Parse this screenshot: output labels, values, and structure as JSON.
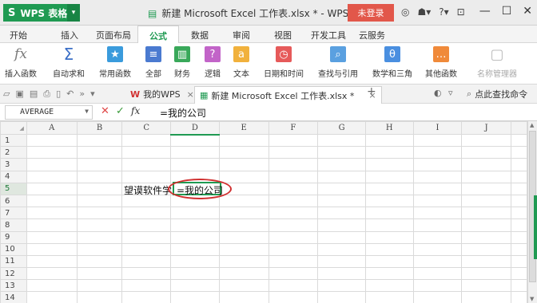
{
  "titlebar": {
    "app_name": "WPS 表格",
    "document_title": "新建 Microsoft Excel 工作表.xlsx * - WPS 表格",
    "login_label": "未登录",
    "min_icon": "minimize-icon",
    "max_icon": "maximize-icon",
    "close_icon": "close-icon"
  },
  "menu": {
    "tabs": [
      "开始",
      "插入",
      "页面布局",
      "公式",
      "数据",
      "审阅",
      "视图",
      "开发工具",
      "云服务"
    ],
    "active": "公式"
  },
  "ribbon": {
    "buttons": [
      {
        "label": "插入函数",
        "icon": "fx-icon",
        "color": "#7a7a7a"
      },
      {
        "label": "自动求和",
        "icon": "sigma-icon",
        "color": "#3b6fc7"
      },
      {
        "label": "常用函数",
        "icon": "star-box-icon",
        "color": "#3a9bdc"
      },
      {
        "label": "全部",
        "icon": "list-box-icon",
        "color": "#4a7ad0"
      },
      {
        "label": "财务",
        "icon": "finance-box-icon",
        "color": "#39a85a"
      },
      {
        "label": "逻辑",
        "icon": "question-box-icon",
        "color": "#c264c8"
      },
      {
        "label": "文本",
        "icon": "text-box-icon",
        "color": "#f1b13c"
      },
      {
        "label": "日期和时间",
        "icon": "clock-box-icon",
        "color": "#e65a5a"
      },
      {
        "label": "查找与引用",
        "icon": "search-box-icon",
        "color": "#5aa0e0"
      },
      {
        "label": "数学和三角",
        "icon": "theta-box-icon",
        "color": "#4a8fe0"
      },
      {
        "label": "其他函数",
        "icon": "more-box-icon",
        "color": "#f08a3a"
      },
      {
        "label": "名称管理器",
        "icon": "name-manager-icon",
        "color": "#bbbbbb"
      }
    ]
  },
  "quickbar": {
    "tab_wps": "我的WPS",
    "tab_doc": "新建 Microsoft Excel 工作表.xlsx *",
    "find_label": "点此查找命令"
  },
  "formula_bar": {
    "name_box": "AVERAGE",
    "fx_label": "fx",
    "formula": "=我的公司"
  },
  "sheet": {
    "columns": [
      "A",
      "B",
      "C",
      "D",
      "E",
      "F",
      "G",
      "H",
      "I",
      "J"
    ],
    "rows": [
      "1",
      "2",
      "3",
      "4",
      "5",
      "6",
      "7",
      "8",
      "9",
      "10",
      "11",
      "12",
      "13",
      "14"
    ],
    "selected_column": "D",
    "selected_row": "5",
    "cell_C5": "望谟软件学",
    "cell_D5": "=我的公司"
  }
}
